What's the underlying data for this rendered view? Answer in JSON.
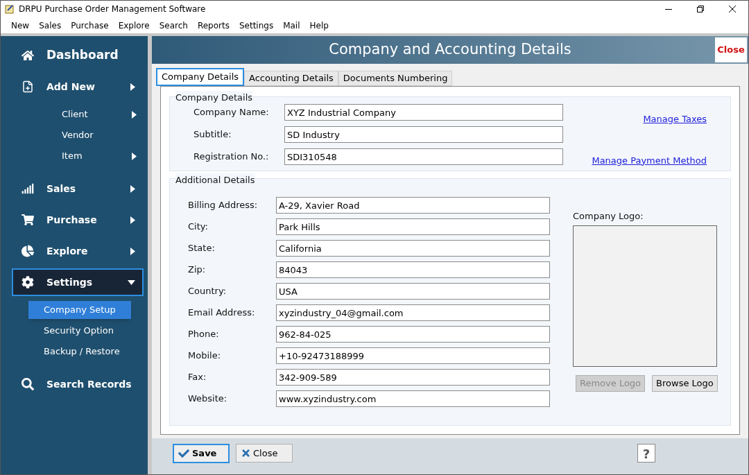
{
  "window": {
    "title": "DRPU Purchase Order Management Software"
  },
  "menu": [
    "New",
    "Sales",
    "Purchase",
    "Explore",
    "Search",
    "Reports",
    "Settings",
    "Mail",
    "Help"
  ],
  "sidebar": {
    "items": [
      {
        "label": "Dashboard",
        "kind": "title",
        "submenu": false,
        "selected": false
      },
      {
        "label": "Add New",
        "kind": "section",
        "submenu": true,
        "selected": false,
        "children": [
          {
            "label": "Client",
            "submenu": true,
            "selected": false
          },
          {
            "label": "Vendor",
            "submenu": false,
            "selected": false
          },
          {
            "label": "Item",
            "submenu": true,
            "selected": false
          }
        ]
      },
      {
        "label": "Sales",
        "kind": "section",
        "submenu": true,
        "selected": false
      },
      {
        "label": "Purchase",
        "kind": "section",
        "submenu": true,
        "selected": false
      },
      {
        "label": "Explore",
        "kind": "section",
        "submenu": true,
        "selected": false
      },
      {
        "label": "Settings",
        "kind": "section",
        "submenu": true,
        "selected": true,
        "children": [
          {
            "label": "Company Setup",
            "submenu": false,
            "selected": true
          },
          {
            "label": "Security Option",
            "submenu": false,
            "selected": false
          },
          {
            "label": "Backup / Restore",
            "submenu": false,
            "selected": false
          }
        ]
      },
      {
        "label": "Search Records",
        "kind": "section",
        "submenu": false,
        "selected": false
      }
    ]
  },
  "header": {
    "title": "Company and Accounting Details",
    "close": "Close"
  },
  "tabs": [
    {
      "label": "Company Details",
      "selected": true
    },
    {
      "label": "Accounting Details",
      "selected": false
    },
    {
      "label": "Documents Numbering",
      "selected": false
    }
  ],
  "company_details": {
    "title": "Company Details",
    "fields": [
      {
        "label": "Company Name:",
        "value": "XYZ Industrial Company"
      },
      {
        "label": "Subtitle:",
        "value": "SD Industry"
      },
      {
        "label": "Registration No.:",
        "value": "SDI310548"
      }
    ],
    "links": [
      "Manage Taxes",
      "Manage Payment Method"
    ]
  },
  "additional_details": {
    "title": "Additional Details",
    "fields": [
      {
        "label": "Billing Address:",
        "value": "A-29, Xavier Road"
      },
      {
        "label": "City:",
        "value": "Park Hills"
      },
      {
        "label": "State:",
        "value": "California"
      },
      {
        "label": "Zip:",
        "value": "84043"
      },
      {
        "label": "Country:",
        "value": "USA"
      },
      {
        "label": "Email Address:",
        "value": "xyzindustry_04@gmail.com"
      },
      {
        "label": "Phone:",
        "value": "962-84-025"
      },
      {
        "label": "Mobile:",
        "value": "+10-92473188999"
      },
      {
        "label": "Fax:",
        "value": "342-909-589"
      },
      {
        "label": "Website:",
        "value": "www.xyzindustry.com"
      }
    ],
    "logo_label": "Company Logo:",
    "logo_buttons": [
      {
        "label": "Remove Logo",
        "disabled": true
      },
      {
        "label": "Browse Logo",
        "disabled": false
      }
    ]
  },
  "footer": {
    "save": "Save",
    "close": "Close",
    "help": "?"
  }
}
